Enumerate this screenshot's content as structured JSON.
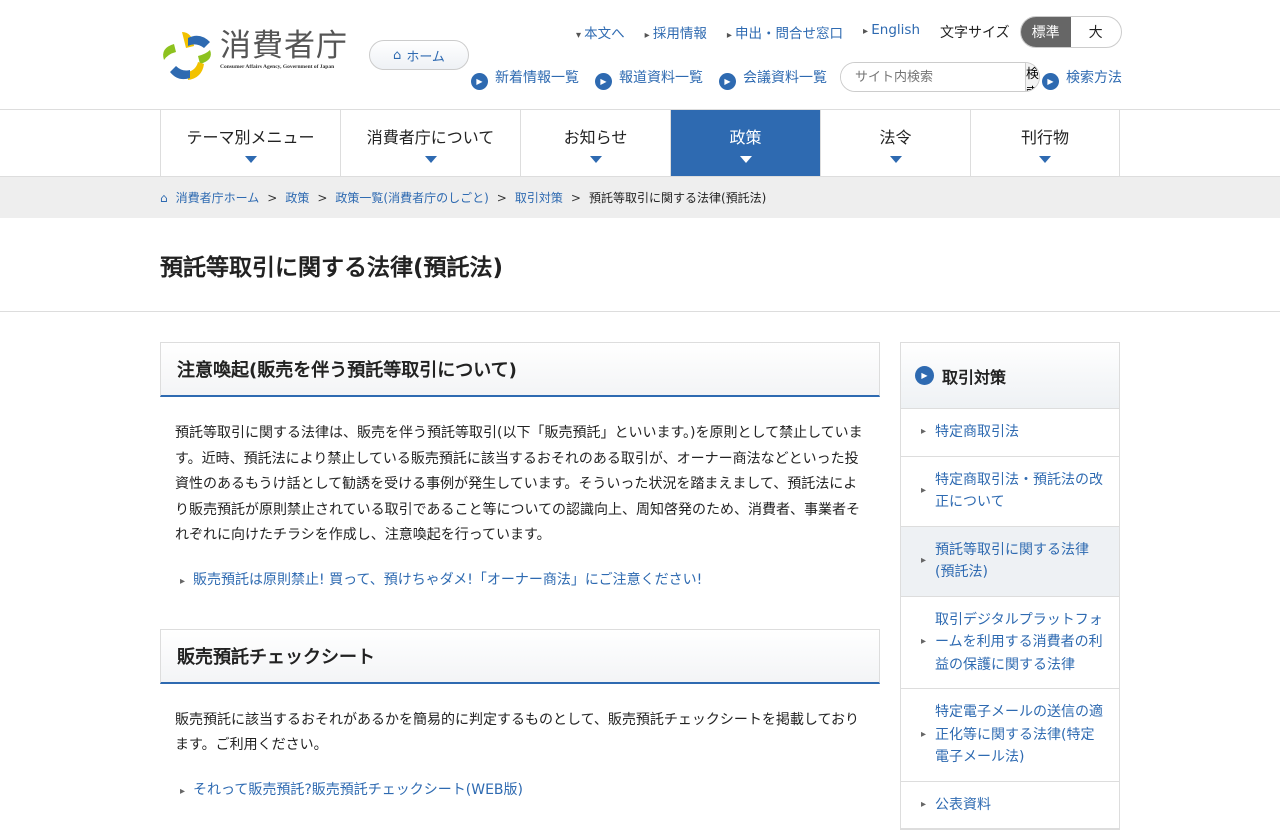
{
  "header": {
    "logo_kanji": "消費者庁",
    "logo_en": "Consumer Affairs Agency, Government of Japan",
    "home": "ホーム",
    "top_links": [
      "本文へ",
      "採用情報",
      "申出・問合せ窓口",
      "English"
    ],
    "font_size_label": "文字サイズ",
    "font_std": "標準",
    "font_large": "大",
    "links": [
      "新着情報一覧",
      "報道資料一覧",
      "会議資料一覧"
    ],
    "search_placeholder": "サイト内検索",
    "search_button": "検索",
    "search_help": "検索方法"
  },
  "nav": [
    "テーマ別メニュー",
    "消費者庁について",
    "お知らせ",
    "政策",
    "法令",
    "刊行物"
  ],
  "breadcrumb": [
    "消費者庁ホーム",
    "政策",
    "政策一覧(消費者庁のしごと)",
    "取引対策",
    "預託等取引に関する法律(預託法)"
  ],
  "page_title": "預託等取引に関する法律(預託法)",
  "sections": [
    {
      "heading": "注意喚起(販売を伴う預託等取引について)",
      "body": "預託等取引に関する法律は、販売を伴う預託等取引(以下「販売預託」といいます。)を原則として禁止しています。近時、預託法により禁止している販売預託に該当するおそれのある取引が、オーナー商法などといった投資性のあるもうけ話として勧誘を受ける事例が発生しています。そういった状況を踏まえまして、預託法により販売預託が原則禁止されている取引であること等についての認識向上、周知啓発のため、消費者、事業者それぞれに向けたチラシを作成し、注意喚起を行っています。",
      "link": "販売預託は原則禁止! 買って、預けちゃダメ!「オーナー商法」にご注意ください!"
    },
    {
      "heading": "販売預託チェックシート",
      "body": "販売預託に該当するおそれがあるかを簡易的に判定するものとして、販売預託チェックシートを掲載しております。ご利用ください。",
      "link": "それって販売預託?販売預託チェックシート(WEB版)"
    }
  ],
  "sidebar": {
    "heading": "取引対策",
    "items": [
      "特定商取引法",
      "特定商取引法・預託法の改正について",
      "預託等取引に関する法律(預託法)",
      "取引デジタルプラットフォームを利用する消費者の利益の保護に関する法律",
      "特定電子メールの送信の適正化等に関する法律(特定電子メール法)",
      "公表資料"
    ]
  }
}
